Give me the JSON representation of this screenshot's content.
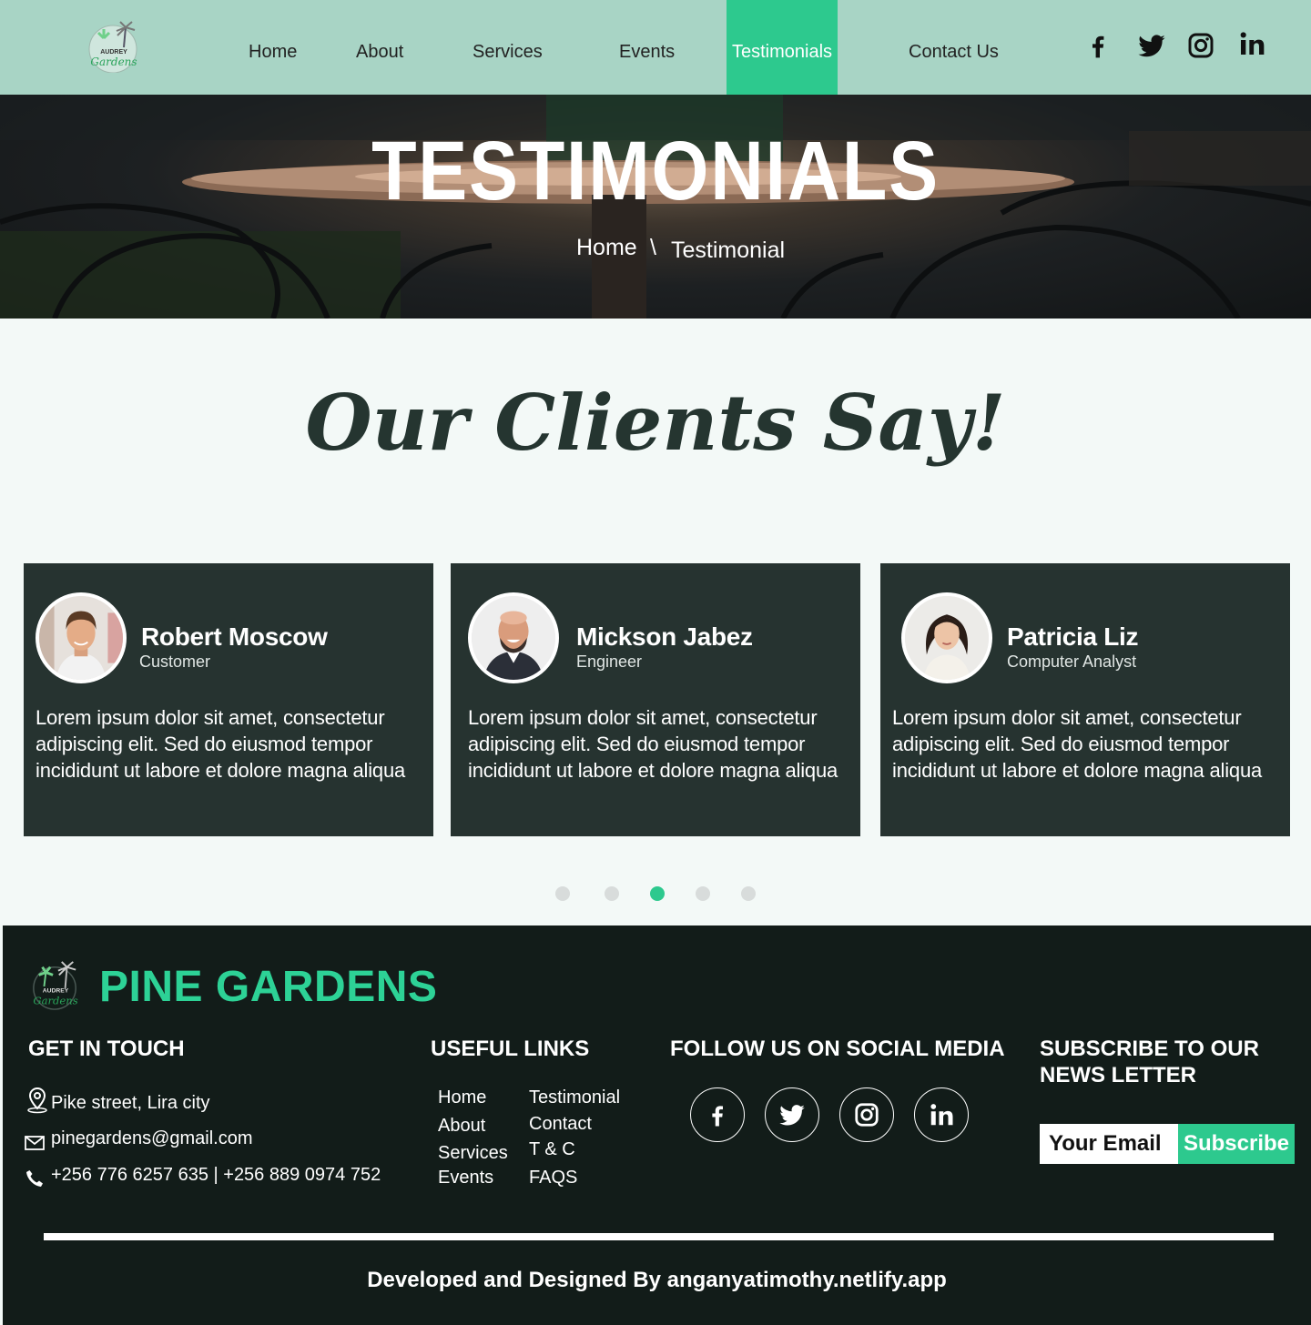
{
  "nav": {
    "logo_text_top": "AUDREY",
    "logo_text_bottom": "Gardens",
    "links": [
      "Home",
      "About",
      "Services",
      "Events",
      "Testimonials",
      "Contact Us"
    ],
    "active": "Testimonials",
    "social_icons": [
      "facebook-icon",
      "twitter-icon",
      "instagram-icon",
      "linkedin-icon"
    ]
  },
  "hero": {
    "title": "TESTIMONIALS",
    "breadcrumb": {
      "home": "Home",
      "separator": "\\",
      "current": "Testimonial"
    }
  },
  "clients": {
    "heading": "Our Clients Say!",
    "cards": [
      {
        "name": "Robert Moscow",
        "role": "Customer",
        "text": "Lorem ipsum dolor sit amet, consectetur adipiscing elit. Sed do eiusmod tempor incididunt ut labore et dolore magna aliqua"
      },
      {
        "name": "Mickson Jabez",
        "role": "Engineer",
        "text": "Lorem ipsum dolor sit amet, consectetur adipiscing elit. Sed do eiusmod tempor incididunt ut labore et dolore magna aliqua"
      },
      {
        "name": "Patricia Liz",
        "role": "Computer Analyst",
        "text": "Lorem ipsum dolor sit amet, consectetur adipiscing elit. Sed do eiusmod tempor incididunt ut labore et dolore magna aliqua"
      }
    ],
    "carousel": {
      "total": 5,
      "active_index": 3
    }
  },
  "footer": {
    "brand": "PINE GARDENS",
    "get_in_touch": {
      "heading": "GET IN TOUCH",
      "address": "Pike street, Lira city",
      "email": "pinegardens@gmail.com",
      "phone": "+256 776 6257 635 | +256 889 0974 752"
    },
    "useful_links": {
      "heading": "USEFUL LINKS",
      "col1": [
        "Home",
        "About",
        "Services",
        "Events"
      ],
      "col2": [
        "Testimonial",
        "Contact",
        "T & C",
        "FAQS"
      ]
    },
    "social": {
      "heading": "FOLLOW US ON SOCIAL MEDIA",
      "icons": [
        "facebook-icon",
        "twitter-icon",
        "instagram-icon",
        "linkedin-icon"
      ]
    },
    "newsletter": {
      "heading_line1": "SUBSCRIBE TO OUR",
      "heading_line2": "NEWS LETTER",
      "email_placeholder": "Your Email",
      "button": "Subscribe"
    },
    "credit": "Developed and Designed By anganyatimothy.netlify.app"
  },
  "colors": {
    "nav_bg": "#a8d4c5",
    "accent": "#2dc98e",
    "card_bg": "#263330",
    "footer_bg": "#121c19",
    "brand_green": "#2dd296"
  }
}
